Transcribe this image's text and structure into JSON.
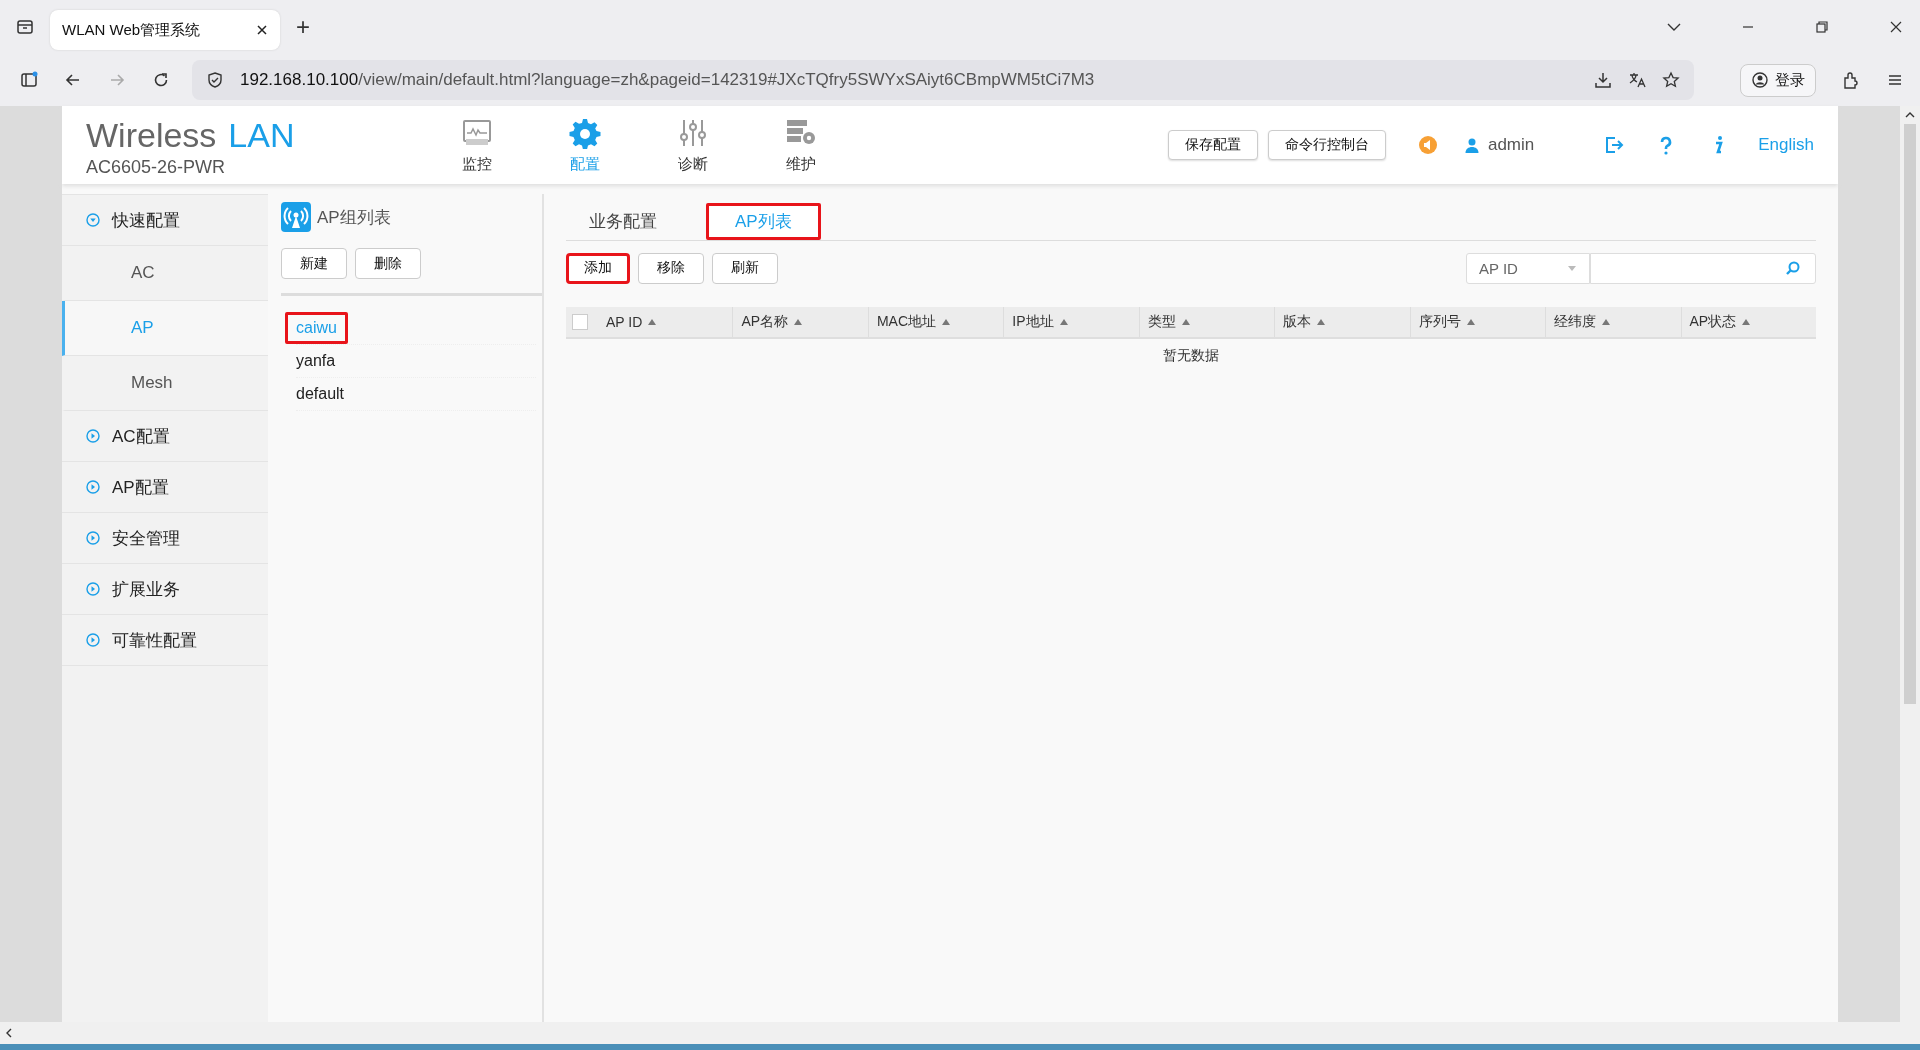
{
  "browser": {
    "tab_title": "WLAN Web管理系统",
    "new_tab": "+",
    "url_host": "192.168.10.100",
    "url_path": "/view/main/default.html?language=zh&pageid=142319#JXcTQfry5SWYxSAiyt6CBmpWM5tCi7M3",
    "sign_in": "登录"
  },
  "header": {
    "logo_main": "Wireless",
    "logo_accent": "LAN",
    "model": "AC6605-26-PWR",
    "nav": [
      {
        "label": "监控",
        "kind": "monitor",
        "selected": false
      },
      {
        "label": "配置",
        "kind": "gear",
        "selected": true
      },
      {
        "label": "诊断",
        "kind": "sliders",
        "selected": false
      },
      {
        "label": "维护",
        "kind": "server",
        "selected": false
      }
    ],
    "buttons": [
      "保存配置",
      "命令行控制台"
    ],
    "user": "admin",
    "language": "English"
  },
  "sidebar": {
    "items": [
      {
        "label": "快速配置",
        "kind": "group",
        "expanded": true,
        "selected": false,
        "children": [
          {
            "label": "AC",
            "kind": "sub",
            "selected": false
          },
          {
            "label": "AP",
            "kind": "sub",
            "selected": true
          },
          {
            "label": "Mesh",
            "kind": "sub",
            "selected": false
          }
        ]
      },
      {
        "label": "AC配置",
        "kind": "group",
        "expanded": false,
        "selected": false
      },
      {
        "label": "AP配置",
        "kind": "group",
        "expanded": false,
        "selected": false
      },
      {
        "label": "安全管理",
        "kind": "group",
        "expanded": false,
        "selected": false
      },
      {
        "label": "扩展业务",
        "kind": "group",
        "expanded": false,
        "selected": false
      },
      {
        "label": "可靠性配置",
        "kind": "group",
        "expanded": false,
        "selected": false
      }
    ]
  },
  "group_panel": {
    "title": "AP组列表",
    "buttons": [
      "新建",
      "删除"
    ],
    "groups": [
      {
        "name": "caiwu",
        "selected": true,
        "highlighted": true
      },
      {
        "name": "yanfa",
        "selected": false,
        "highlighted": false
      },
      {
        "name": "default",
        "selected": false,
        "highlighted": false
      }
    ]
  },
  "main": {
    "tabs": [
      {
        "label": "业务配置",
        "selected": false,
        "highlighted": false
      },
      {
        "label": "AP列表",
        "selected": true,
        "highlighted": true
      }
    ],
    "actions": [
      {
        "label": "添加",
        "highlighted": true
      },
      {
        "label": "移除",
        "highlighted": false
      },
      {
        "label": "刷新",
        "highlighted": false
      }
    ],
    "filter": {
      "field": "AP ID"
    },
    "table": {
      "select_all_checked": false,
      "columns": [
        "AP ID",
        "AP名称",
        "MAC地址",
        "IP地址",
        "类型",
        "版本",
        "序列号",
        "经纬度",
        "AP状态"
      ],
      "empty_text": "暂无数据"
    }
  }
}
